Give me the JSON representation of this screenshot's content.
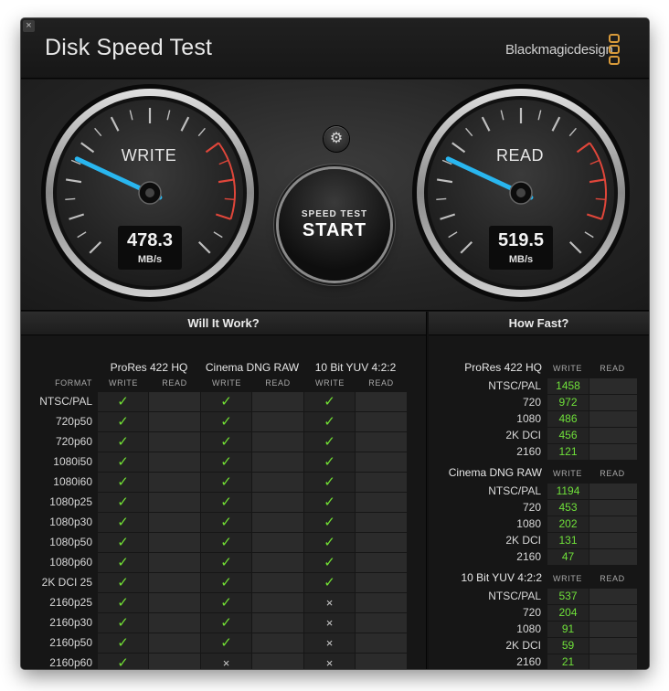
{
  "window": {
    "title": "Disk Speed Test",
    "brand": "Blackmagicdesign",
    "close_glyph": "×",
    "accent_color": "#d89a3a"
  },
  "gauges": {
    "write": {
      "label": "WRITE",
      "value": "478.3",
      "unit": "MB/s",
      "needle_color": "#29b6ef"
    },
    "read": {
      "label": "READ",
      "value": "519.5",
      "unit": "MB/s",
      "needle_color": "#29b6ef"
    }
  },
  "controls": {
    "settings_icon": "gear-icon",
    "settings_glyph": "⚙",
    "start_sub": "SPEED TEST",
    "start_main": "START"
  },
  "will_it_work": {
    "title": "Will It Work?",
    "format_header": "FORMAT",
    "write_header": "WRITE",
    "read_header": "READ",
    "codecs": [
      "ProRes 422 HQ",
      "Cinema DNG RAW",
      "10 Bit YUV 4:2:2"
    ],
    "check_glyph": "✓",
    "cross_glyph": "×",
    "rows": [
      {
        "format": "NTSC/PAL",
        "results": [
          true,
          true,
          true
        ]
      },
      {
        "format": "720p50",
        "results": [
          true,
          true,
          true
        ]
      },
      {
        "format": "720p60",
        "results": [
          true,
          true,
          true
        ]
      },
      {
        "format": "1080i50",
        "results": [
          true,
          true,
          true
        ]
      },
      {
        "format": "1080i60",
        "results": [
          true,
          true,
          true
        ]
      },
      {
        "format": "1080p25",
        "results": [
          true,
          true,
          true
        ]
      },
      {
        "format": "1080p30",
        "results": [
          true,
          true,
          true
        ]
      },
      {
        "format": "1080p50",
        "results": [
          true,
          true,
          true
        ]
      },
      {
        "format": "1080p60",
        "results": [
          true,
          true,
          true
        ]
      },
      {
        "format": "2K DCI 25",
        "results": [
          true,
          true,
          true
        ]
      },
      {
        "format": "2160p25",
        "results": [
          true,
          true,
          false
        ]
      },
      {
        "format": "2160p30",
        "results": [
          true,
          true,
          false
        ]
      },
      {
        "format": "2160p50",
        "results": [
          true,
          true,
          false
        ]
      },
      {
        "format": "2160p60",
        "results": [
          true,
          false,
          false
        ]
      }
    ]
  },
  "how_fast": {
    "title": "How Fast?",
    "write_header": "WRITE",
    "read_header": "READ",
    "groups": [
      {
        "codec": "ProRes 422 HQ",
        "rows": [
          {
            "res": "NTSC/PAL",
            "write": "1458"
          },
          {
            "res": "720",
            "write": "972"
          },
          {
            "res": "1080",
            "write": "486"
          },
          {
            "res": "2K DCI",
            "write": "456"
          },
          {
            "res": "2160",
            "write": "121"
          }
        ]
      },
      {
        "codec": "Cinema DNG RAW",
        "rows": [
          {
            "res": "NTSC/PAL",
            "write": "1194"
          },
          {
            "res": "720",
            "write": "453"
          },
          {
            "res": "1080",
            "write": "202"
          },
          {
            "res": "2K DCI",
            "write": "131"
          },
          {
            "res": "2160",
            "write": "47"
          }
        ]
      },
      {
        "codec": "10 Bit YUV 4:2:2",
        "rows": [
          {
            "res": "NTSC/PAL",
            "write": "537"
          },
          {
            "res": "720",
            "write": "204"
          },
          {
            "res": "1080",
            "write": "91"
          },
          {
            "res": "2K DCI",
            "write": "59"
          },
          {
            "res": "2160",
            "write": "21"
          }
        ]
      }
    ]
  }
}
